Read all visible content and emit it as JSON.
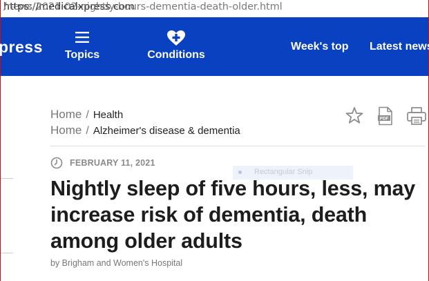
{
  "browser": {
    "url_host": "https://medicalxpress.com",
    "url_path": "/news/2021-02-nightly-hours-dementia-death-older.html"
  },
  "navbar": {
    "brand_fragment": "press",
    "topics_label": "Topics",
    "conditions_label": "Conditions",
    "weeks_top_label": "Week's top",
    "latest_news_label": "Latest news",
    "background_color": "#0a41c0"
  },
  "breadcrumbs": [
    {
      "home": "Home",
      "separator": "/",
      "topic": "Health"
    },
    {
      "home": "Home",
      "separator": "/",
      "topic": "Alzheimer's disease & dementia"
    }
  ],
  "actions": {
    "star_icon": "star-icon",
    "pdf_icon": "pdf-icon",
    "pdf_text": "PDF",
    "print_icon": "printer-icon"
  },
  "article": {
    "date": "FEBRUARY 11, 2021",
    "title": "Nightly sleep of five hours, less, may increase risk of dementia, death among older adults",
    "byline": "by Brigham and Women's Hospital"
  },
  "overlay": {
    "snip_label": "Rectangular Snip"
  }
}
